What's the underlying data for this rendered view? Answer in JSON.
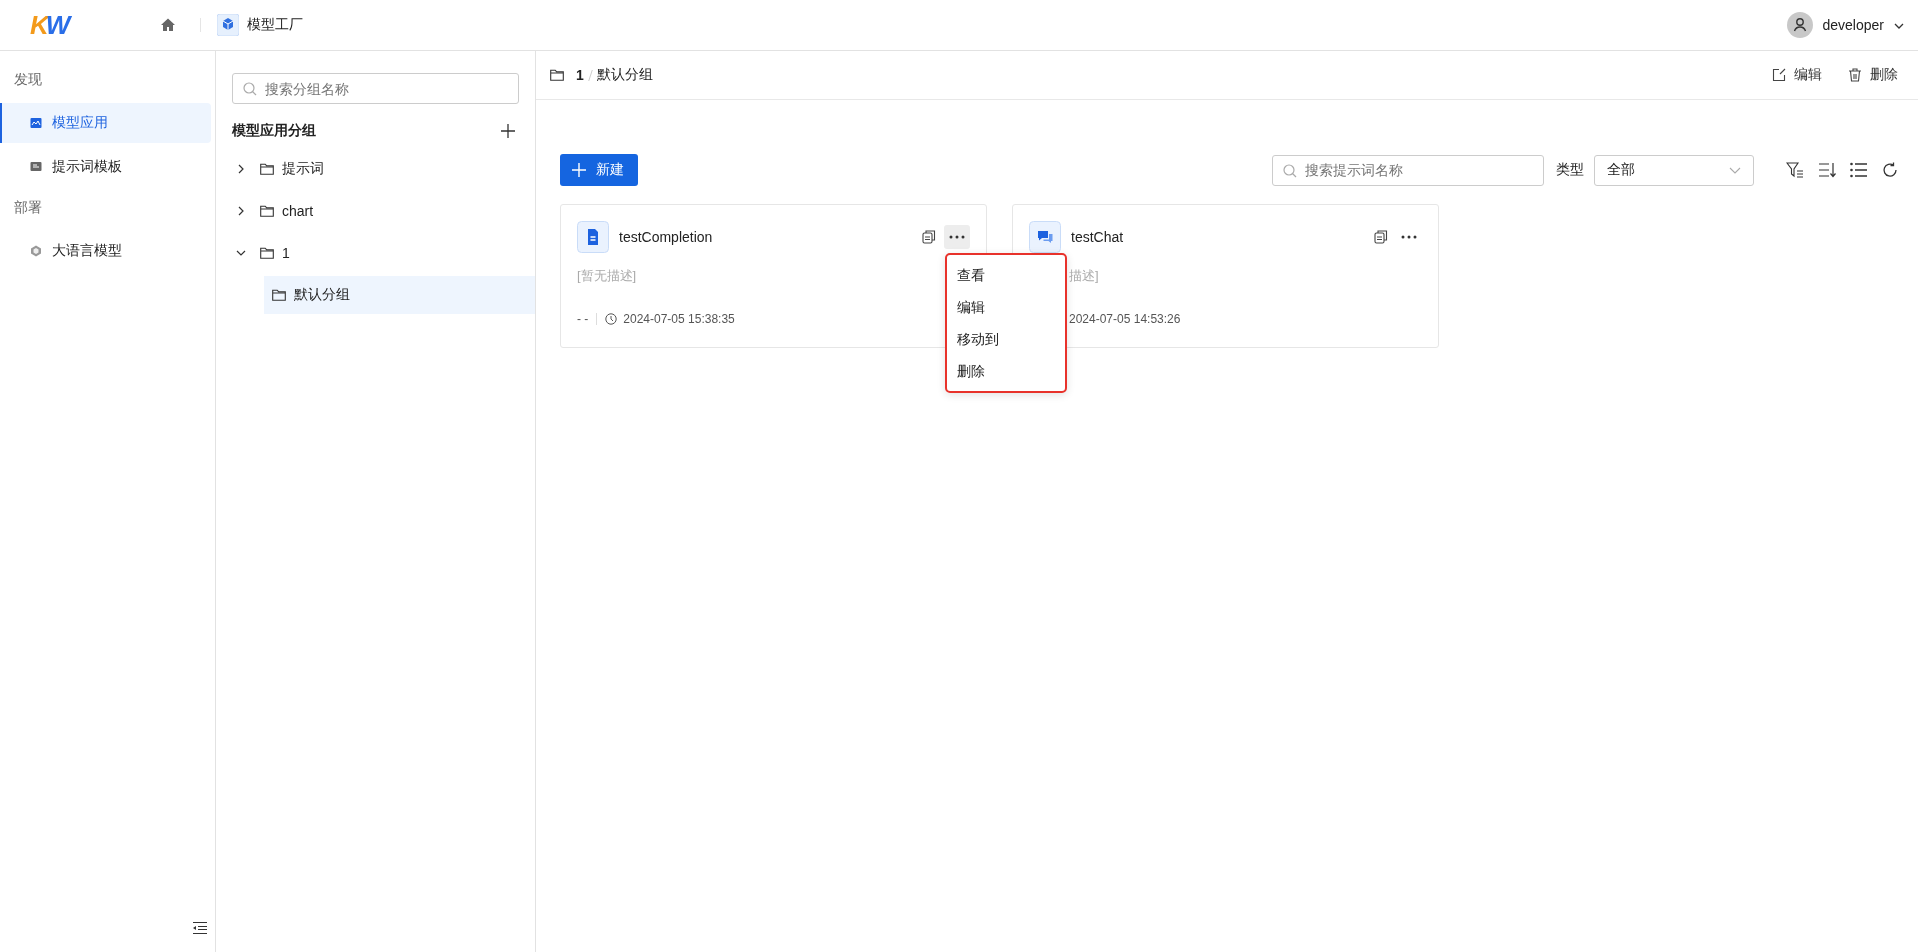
{
  "header": {
    "logo": "KW",
    "app_name": "模型工厂",
    "user": "developer"
  },
  "nav": {
    "sections": [
      {
        "title": "发现",
        "items": [
          {
            "label": "模型应用",
            "kind": "app",
            "selected": true
          },
          {
            "label": "提示词模板",
            "kind": "template",
            "selected": false
          }
        ]
      },
      {
        "title": "部署",
        "items": [
          {
            "label": "大语言模型",
            "kind": "model",
            "selected": false
          }
        ]
      }
    ]
  },
  "groups": {
    "search_placeholder": "搜索分组名称",
    "title": "模型应用分组",
    "tree": [
      {
        "label": "提示词",
        "expanded": false,
        "selected": false
      },
      {
        "label": "chart",
        "expanded": false,
        "selected": false
      },
      {
        "label": "1",
        "expanded": true,
        "selected": false,
        "children": [
          {
            "label": "默认分组",
            "selected": true
          }
        ]
      }
    ]
  },
  "breadcrumb": [
    "1",
    "默认分组"
  ],
  "actions": [
    "编辑",
    "删除"
  ],
  "toolbar": {
    "new_button": "新建",
    "search_placeholder": "搜索提示词名称",
    "type_label": "类型",
    "type_value": "全部"
  },
  "cards": [
    {
      "name": "testCompletion",
      "kind": "completion",
      "description": "[暂无描述]",
      "author": "- -",
      "time": "2024-07-05 15:38:35"
    },
    {
      "name": "testChat",
      "kind": "chat",
      "description": "描述]",
      "time": "2024-07-05 14:53:26"
    }
  ],
  "context_menu": [
    "查看",
    "编辑",
    "移动到",
    "删除"
  ]
}
